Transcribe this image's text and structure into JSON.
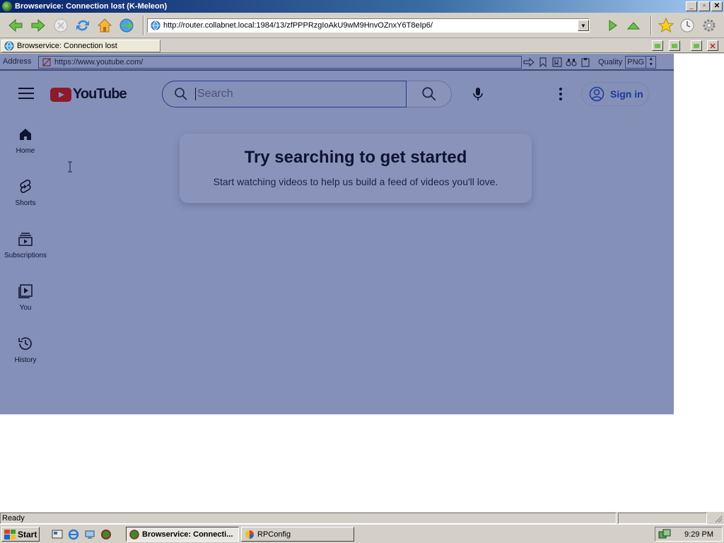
{
  "window": {
    "title": "Browservice: Connection lost (K-Meleon)",
    "buttons": {
      "minimize": "_",
      "restore": "▫",
      "close": "✕"
    }
  },
  "toolbar": {
    "url": "http://router.collabnet.local:1984/13/zfPPPRzgIoAkU9wM9HnvOZnxY6T8eIp6/",
    "url_dropdown": "▼"
  },
  "tabs": [
    {
      "label": "Browservice: Connection lost"
    }
  ],
  "inner_address": {
    "label": "Address",
    "url": "https://www.youtube.com/",
    "quality_label": "Quality",
    "quality_value": "PNG"
  },
  "youtube": {
    "logo_text": "YouTube",
    "search_placeholder": "Search",
    "sign_in": "Sign in",
    "nav": [
      {
        "label": "Home",
        "icon": "home-icon"
      },
      {
        "label": "Shorts",
        "icon": "shorts-icon"
      },
      {
        "label": "Subscriptions",
        "icon": "subscriptions-icon"
      },
      {
        "label": "You",
        "icon": "you-icon"
      },
      {
        "label": "History",
        "icon": "history-icon"
      }
    ],
    "card": {
      "title": "Try searching to get started",
      "subtitle": "Start watching videos to help us build a feed of videos you'll love."
    },
    "colors": {
      "overlay": "#8590b8",
      "text": "#0e1430",
      "accent": "#1a3a9a"
    }
  },
  "status": {
    "text": "Ready"
  },
  "taskbar": {
    "start_label": "Start",
    "tasks": [
      {
        "label": "Browservice: Connecti..."
      },
      {
        "label": "RPConfig"
      }
    ],
    "clock": "9:29 PM"
  }
}
